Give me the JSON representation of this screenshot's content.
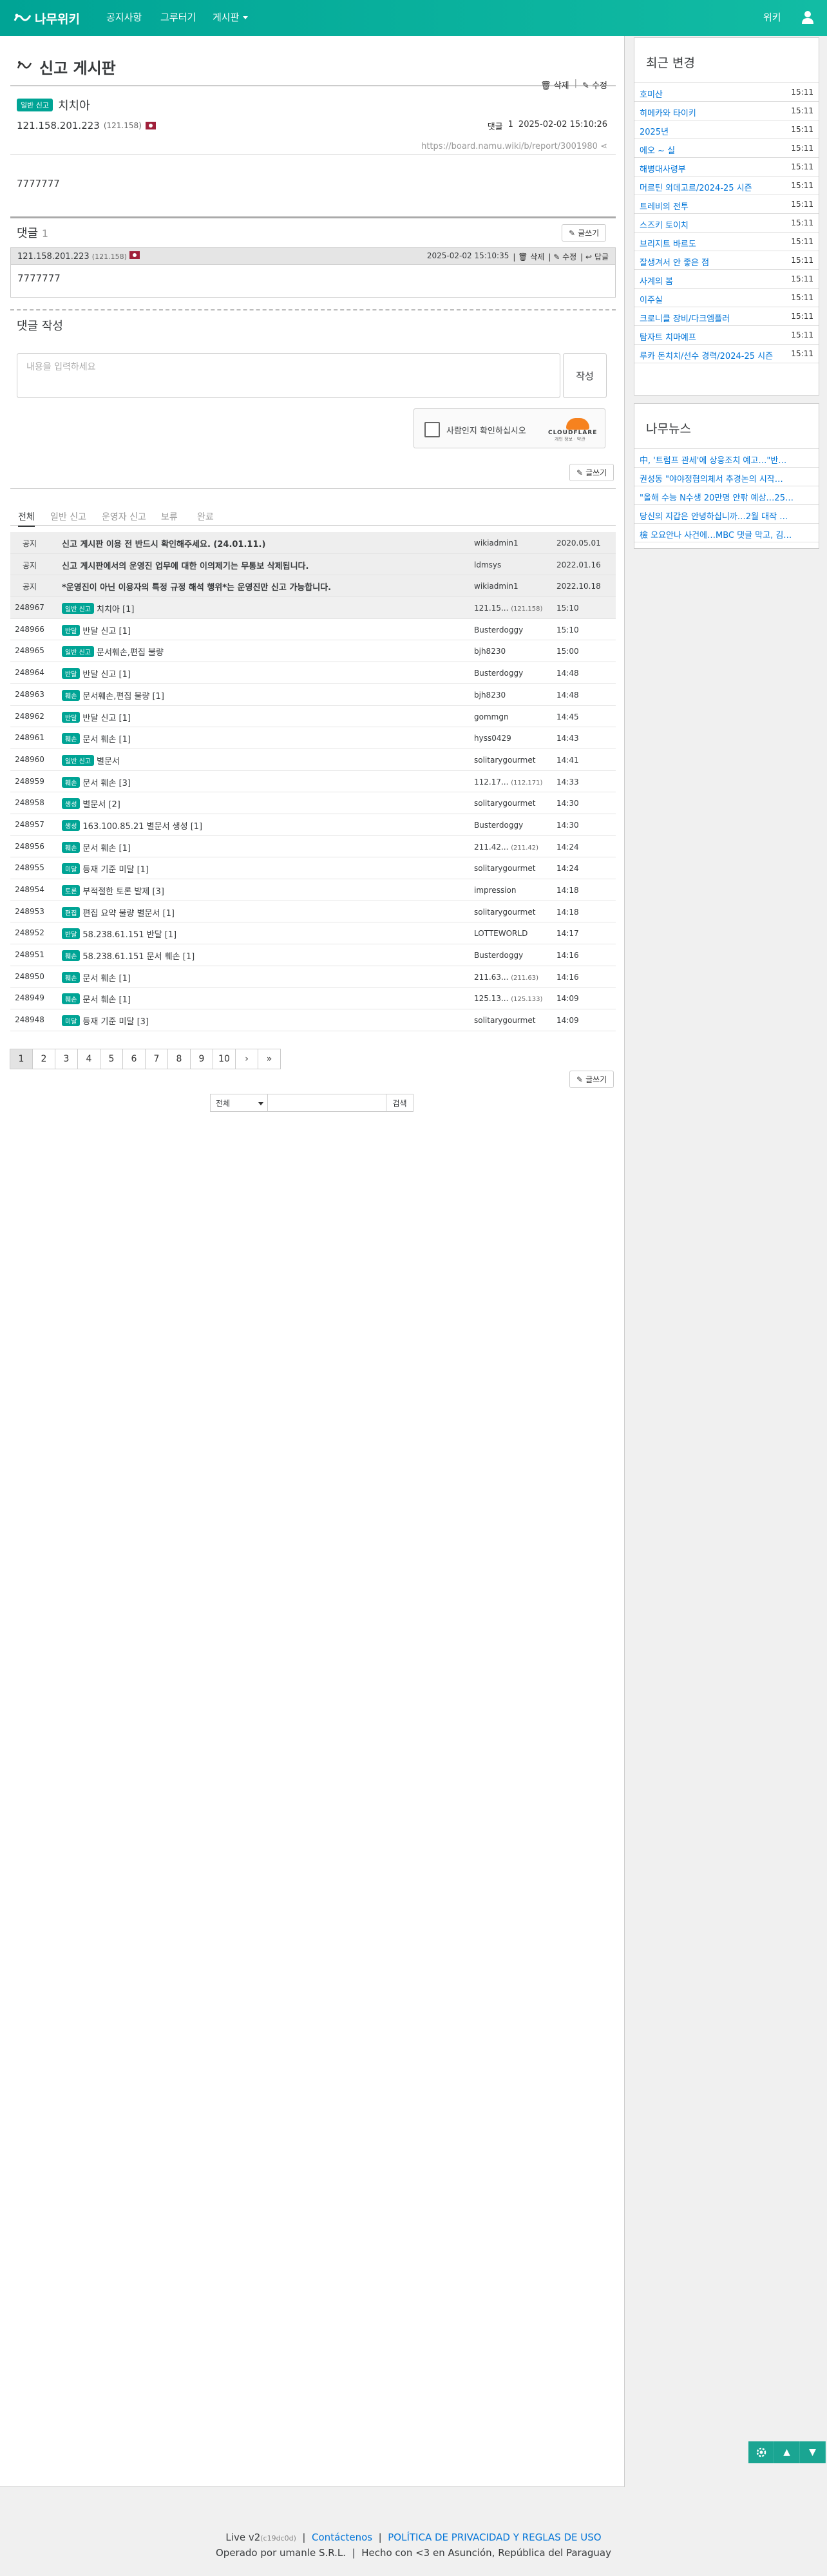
{
  "navbar": {
    "logo_text": "나무위키",
    "links": [
      "공지사항",
      "그루터기",
      "게시판"
    ],
    "user_link": "위키"
  },
  "board": {
    "title": "신고 게시판",
    "actions": [
      "삭제",
      "수정"
    ]
  },
  "post": {
    "badge": "일반 신고",
    "title": "치치아",
    "author_ip": "121.158.201.223",
    "author_ip_short": "(121.158)",
    "comment_label": "댓글",
    "comment_count": "1",
    "date": "2025-02-02 15:10:26",
    "url": "https://board.namu.wiki/b/report/3001980",
    "body": "7777777"
  },
  "comments": {
    "title": "댓글",
    "count": "1",
    "write_button": "글쓰기",
    "items": [
      {
        "ip": "121.158.201.223",
        "ip_short": "(121.158)",
        "date": "2025-02-02 15:10:35",
        "actions": [
          "삭제",
          "수정",
          "답글"
        ],
        "body": "7777777"
      }
    ]
  },
  "write": {
    "title": "댓글 작성",
    "placeholder": "내용을 입력하세요",
    "submit": "작성",
    "captcha_text": "사람인지 확인하십시오",
    "captcha_brand": "CLOUDFLARE",
    "captcha_links": "개인 정보 · 약관"
  },
  "list": {
    "write_button": "글쓰기",
    "tabs": [
      "전체",
      "일반 신고",
      "운영자 신고",
      "보류",
      "완료"
    ],
    "rows": [
      {
        "num": "공지",
        "badge": "",
        "subject": "신고 게시판 이용 전 반드시 확인해주세요. (24.01.11.)",
        "author": "wikiadmin1",
        "author_small": "",
        "date": "2020.05.01",
        "notice": true
      },
      {
        "num": "공지",
        "badge": "",
        "subject": "신고 게시판에서의 운영진 업무에 대한 이의제기는 무통보 삭제됩니다.",
        "author": "ldmsys",
        "author_small": "",
        "date": "2022.01.16",
        "notice": true
      },
      {
        "num": "공지",
        "badge": "",
        "subject": "*운영진이 아닌 이용자의 특정 규정 해석 행위*는 운영진만 신고 가능합니다.",
        "author": "wikiadmin1",
        "author_small": "",
        "date": "2022.10.18",
        "notice": true
      },
      {
        "num": "248967",
        "badge": "일반 신고",
        "subject": "치치아 [1]",
        "author": "121.15...",
        "author_small": "(121.158)",
        "date": "15:10",
        "highlight": true
      },
      {
        "num": "248966",
        "badge": "반달",
        "subject": "반달 신고 [1]",
        "author": "Busterdoggy",
        "author_small": "",
        "date": "15:10"
      },
      {
        "num": "248965",
        "badge": "일반 신고",
        "subject": "문서훼손,편집 불량",
        "author": "bjh8230",
        "author_small": "",
        "date": "15:00"
      },
      {
        "num": "248964",
        "badge": "반달",
        "subject": "반달 신고 [1]",
        "author": "Busterdoggy",
        "author_small": "",
        "date": "14:48"
      },
      {
        "num": "248963",
        "badge": "훼손",
        "subject": "문서훼손,편집 불량 [1]",
        "author": "bjh8230",
        "author_small": "",
        "date": "14:48"
      },
      {
        "num": "248962",
        "badge": "반달",
        "subject": "반달 신고 [1]",
        "author": "gommgn",
        "author_small": "",
        "date": "14:45"
      },
      {
        "num": "248961",
        "badge": "훼손",
        "subject": "문서 훼손 [1]",
        "author": "hyss0429",
        "author_small": "",
        "date": "14:43"
      },
      {
        "num": "248960",
        "badge": "일반 신고",
        "subject": "별문서",
        "author": "solitarygourmet",
        "author_small": "",
        "date": "14:41"
      },
      {
        "num": "248959",
        "badge": "훼손",
        "subject": "문서 훼손 [3]",
        "author": "112.17...",
        "author_small": "(112.171)",
        "date": "14:33"
      },
      {
        "num": "248958",
        "badge": "생성",
        "subject": "별문서 [2]",
        "author": "solitarygourmet",
        "author_small": "",
        "date": "14:30"
      },
      {
        "num": "248957",
        "badge": "생성",
        "subject": "163.100.85.21 별문서 생성 [1]",
        "author": "Busterdoggy",
        "author_small": "",
        "date": "14:30"
      },
      {
        "num": "248956",
        "badge": "훼손",
        "subject": "문서 훼손 [1]",
        "author": "211.42...",
        "author_small": "(211.42)",
        "date": "14:24"
      },
      {
        "num": "248955",
        "badge": "미달",
        "subject": "등재 기준 미달 [1]",
        "author": "solitarygourmet",
        "author_small": "",
        "date": "14:24"
      },
      {
        "num": "248954",
        "badge": "토론",
        "subject": "부적절한 토론 발제 [3]",
        "author": "impression",
        "author_small": "",
        "date": "14:18"
      },
      {
        "num": "248953",
        "badge": "편집",
        "subject": "편집 요약 불량 별문서 [1]",
        "author": "solitarygourmet",
        "author_small": "",
        "date": "14:18"
      },
      {
        "num": "248952",
        "badge": "반달",
        "subject": "58.238.61.151 반달 [1]",
        "author": "LOTTEWORLD",
        "author_small": "",
        "date": "14:17"
      },
      {
        "num": "248951",
        "badge": "훼손",
        "subject": "58.238.61.151 문서 훼손 [1]",
        "author": "Busterdoggy",
        "author_small": "",
        "date": "14:16"
      },
      {
        "num": "248950",
        "badge": "훼손",
        "subject": "문서 훼손 [1]",
        "author": "211.63...",
        "author_small": "(211.63)",
        "date": "14:16"
      },
      {
        "num": "248949",
        "badge": "훼손",
        "subject": "문서 훼손 [1]",
        "author": "125.13...",
        "author_small": "(125.133)",
        "date": "14:09"
      },
      {
        "num": "248948",
        "badge": "미달",
        "subject": "등재 기준 미달 [3]",
        "author": "solitarygourmet",
        "author_small": "",
        "date": "14:09"
      }
    ],
    "pagination": [
      "1",
      "2",
      "3",
      "4",
      "5",
      "6",
      "7",
      "8",
      "9",
      "10",
      "›",
      "»"
    ],
    "search_select": "전체",
    "search_button": "검색"
  },
  "sidebar": {
    "recent_title": "최근 변경",
    "recent": [
      {
        "title": "호미산",
        "time": "15:11"
      },
      {
        "title": "히메카와 타이키",
        "time": "15:11"
      },
      {
        "title": "2025년",
        "time": "15:11"
      },
      {
        "title": "에오 ~ 실",
        "time": "15:11"
      },
      {
        "title": "해병대사령부",
        "time": "15:11"
      },
      {
        "title": "머르틴 외데고르/2024-25 시즌",
        "time": "15:11"
      },
      {
        "title": "트레비의 전투",
        "time": "15:11"
      },
      {
        "title": "스즈키 토이치",
        "time": "15:11"
      },
      {
        "title": "브리지트 바르도",
        "time": "15:11"
      },
      {
        "title": "잘생겨서 안 좋은 점",
        "time": "15:11"
      },
      {
        "title": "사계의 봄",
        "time": "15:11"
      },
      {
        "title": "이주실",
        "time": "15:11"
      },
      {
        "title": "크로니클 장비/다크엠플러",
        "time": "15:11"
      },
      {
        "title": "탐자트 치마예프",
        "time": "15:11"
      },
      {
        "title": "루카 돈치치/선수 경력/2024-25 시즌",
        "time": "15:11"
      }
    ],
    "news_title": "나무뉴스",
    "news": [
      "中, '트럼프 관세'에 상응조치 예고…\"반…",
      "권성동 \"야야정협의체서 추경논의 시작…",
      "\"올해 수능 N수생 20만명 안팎 예상…25…",
      "당신의 지갑은 안녕하십니까…2월 대작 …",
      "檢 오요안나 사건에…MBC 댓글 막고, 김…"
    ]
  },
  "footer": {
    "version": "Live v2",
    "version_hash": "(c19dc0d)",
    "contact": "Contáctenos",
    "policy": "POLÍTICA DE PRIVACIDAD Y REGLAS DE USO",
    "operator": "Operado por umanle S.R.L.",
    "made": "Hecho con <3 en Asunción, República del Paraguay"
  },
  "colors": {
    "brand": "#00a495",
    "link": "#0275d8"
  }
}
